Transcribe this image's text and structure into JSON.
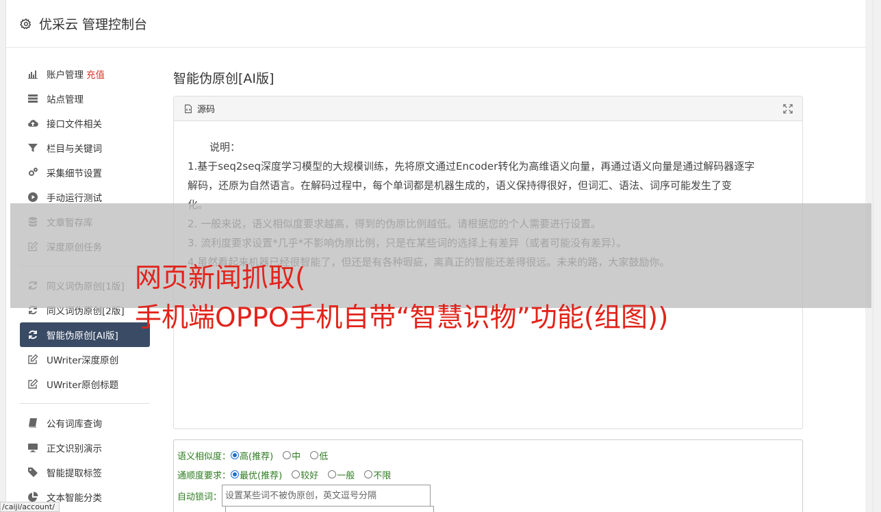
{
  "app": {
    "title": "优采云 管理控制台"
  },
  "sidebar": {
    "groups": [
      [
        {
          "label": "账户管理",
          "extra": "充值",
          "icon": "bar-chart-icon"
        },
        {
          "label": "站点管理",
          "icon": "server-icon"
        },
        {
          "label": "接口文件相关",
          "icon": "cloud-upload-icon"
        },
        {
          "label": "栏目与关键词",
          "icon": "filter-icon"
        },
        {
          "label": "采集细节设置",
          "icon": "gears-icon"
        },
        {
          "label": "手动运行测试",
          "icon": "play-circle-icon"
        },
        {
          "label": "文章暂存库",
          "icon": "database-icon"
        },
        {
          "label": "深度原创任务",
          "icon": "edit-icon"
        }
      ],
      [
        {
          "label": "同义词伪原创[1版]",
          "icon": "refresh-icon"
        },
        {
          "label": "同义词伪原创[2版]",
          "icon": "refresh-icon"
        },
        {
          "label": "智能伪原创[AI版]",
          "icon": "refresh-icon",
          "active": true
        },
        {
          "label": "UWriter深度原创",
          "icon": "edit-icon"
        },
        {
          "label": "UWriter原创标题",
          "icon": "edit-icon"
        }
      ],
      [
        {
          "label": "公有词库查询",
          "icon": "book-icon"
        },
        {
          "label": "正文识别演示",
          "icon": "monitor-icon"
        },
        {
          "label": "智能提取标签",
          "icon": "tag-icon"
        },
        {
          "label": "文本智能分类",
          "icon": "pie-chart-icon"
        }
      ]
    ]
  },
  "main": {
    "title": "智能伪原创[AI版]",
    "panel": {
      "header": "源码",
      "intro": "说明：",
      "lines": [
        "1.基于seq2seq深度学习模型的大规模训练，先将原文通过Encoder转化为高维语义向量，再通过语义向量是通过解码器逐字",
        "解码，还原为自然语言。在解码过程中，每个单词都是机器生成的，语义保持得很好，但词汇、语法、词序可能发生了变",
        "化。",
        "2. 一般来说，语义相似度要求越高，得到的伪原比例越低。请根据您的个人需要进行设置。",
        "3. 流利度要求设置*几乎*不影响伪原比例，只是在某些词的选择上有差异（或者可能没有差异）。",
        "4.虽然看起来机器已经很智能了，但还是有各种瑕疵，离真正的智能还差得很远。未来的路，大家鼓励你。"
      ]
    },
    "form": {
      "similarity": {
        "label": "语义相似度：",
        "options": [
          "高(推荐)",
          "中",
          "低"
        ],
        "selected": 0
      },
      "fluency": {
        "label": "通顺度要求：",
        "options": [
          "最优(推荐)",
          "较好",
          "一般",
          "不限"
        ],
        "selected": 0
      },
      "lock": {
        "label": "自动锁词：",
        "placeholder": "设置某些词不被伪原创，英文逗号分隔"
      }
    }
  },
  "overlay": {
    "line1": "网页新闻抓取(",
    "line2": "手机端OPPO手机自带“智慧识物”功能(组图))"
  },
  "status": {
    "url": "/caiji/account/"
  },
  "colors": {
    "active_nav": "#3a4b65",
    "accent_red": "#d9332d",
    "form_label": "#2d7b1f",
    "headline": "#e2231a"
  }
}
